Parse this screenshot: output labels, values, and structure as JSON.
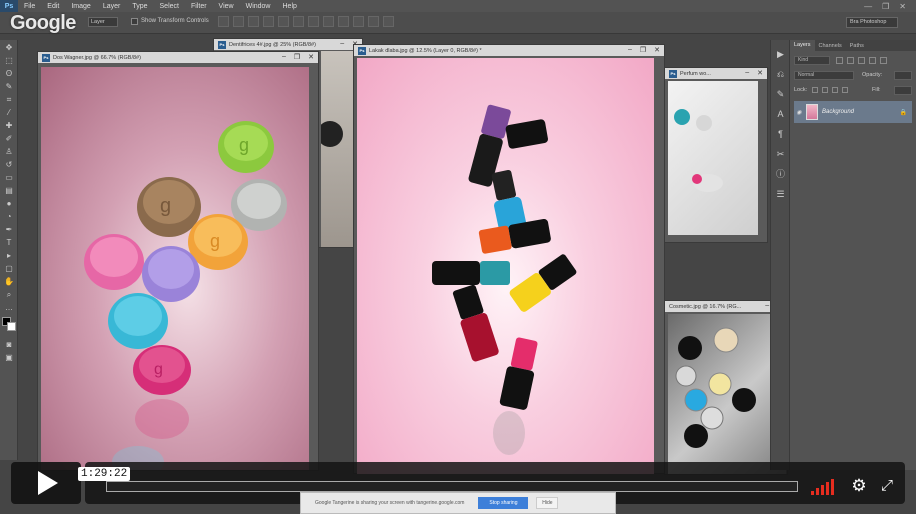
{
  "app": {
    "logo": "Ps",
    "menu": [
      "File",
      "Edit",
      "Image",
      "Layer",
      "Type",
      "Select",
      "Filter",
      "View",
      "Window",
      "Help"
    ],
    "window_controls": [
      "—",
      "❐",
      "✕"
    ]
  },
  "watermark": {
    "brand": "Google"
  },
  "options_bar": {
    "layer_select": "Layer",
    "show_transform_label": "Show Transform Controls",
    "workspace": "Bra Photoshop"
  },
  "documents": {
    "left": {
      "title": "Dos Wagner.jpg @ 66.7% (RGB/8#)"
    },
    "back_small": {
      "title": "Dentifrices 4#.jpg @ 25% (RGB/8#)"
    },
    "center": {
      "title": "Lakak dlaba.jpg @ 12.5% (Layer 0, RGB/8#) *"
    },
    "right_top": {
      "title": "Perfum wo..."
    },
    "right_bottom": {
      "title": "Cosmetic.jpg @ 16.7% (RG..."
    }
  },
  "layers_panel": {
    "tabs": [
      "Layers",
      "Channels",
      "Paths"
    ],
    "kind_label": "Kind",
    "blend_mode": "Normal",
    "opacity_label": "Opacity:",
    "lock_label": "Lock:",
    "fill_label": "Fill:",
    "layer_name": "Background"
  },
  "player": {
    "timecode": "1:29:22",
    "progress": 0.0
  },
  "notification": {
    "text": "Google Tangerine is sharing your screen with tangerine.google.com",
    "button_primary": "Stop sharing",
    "button_secondary": "Hide"
  },
  "colors": {
    "accent": "#e62d1f",
    "pink_bg": "#f5b9cf",
    "ps_panel": "#535353"
  }
}
